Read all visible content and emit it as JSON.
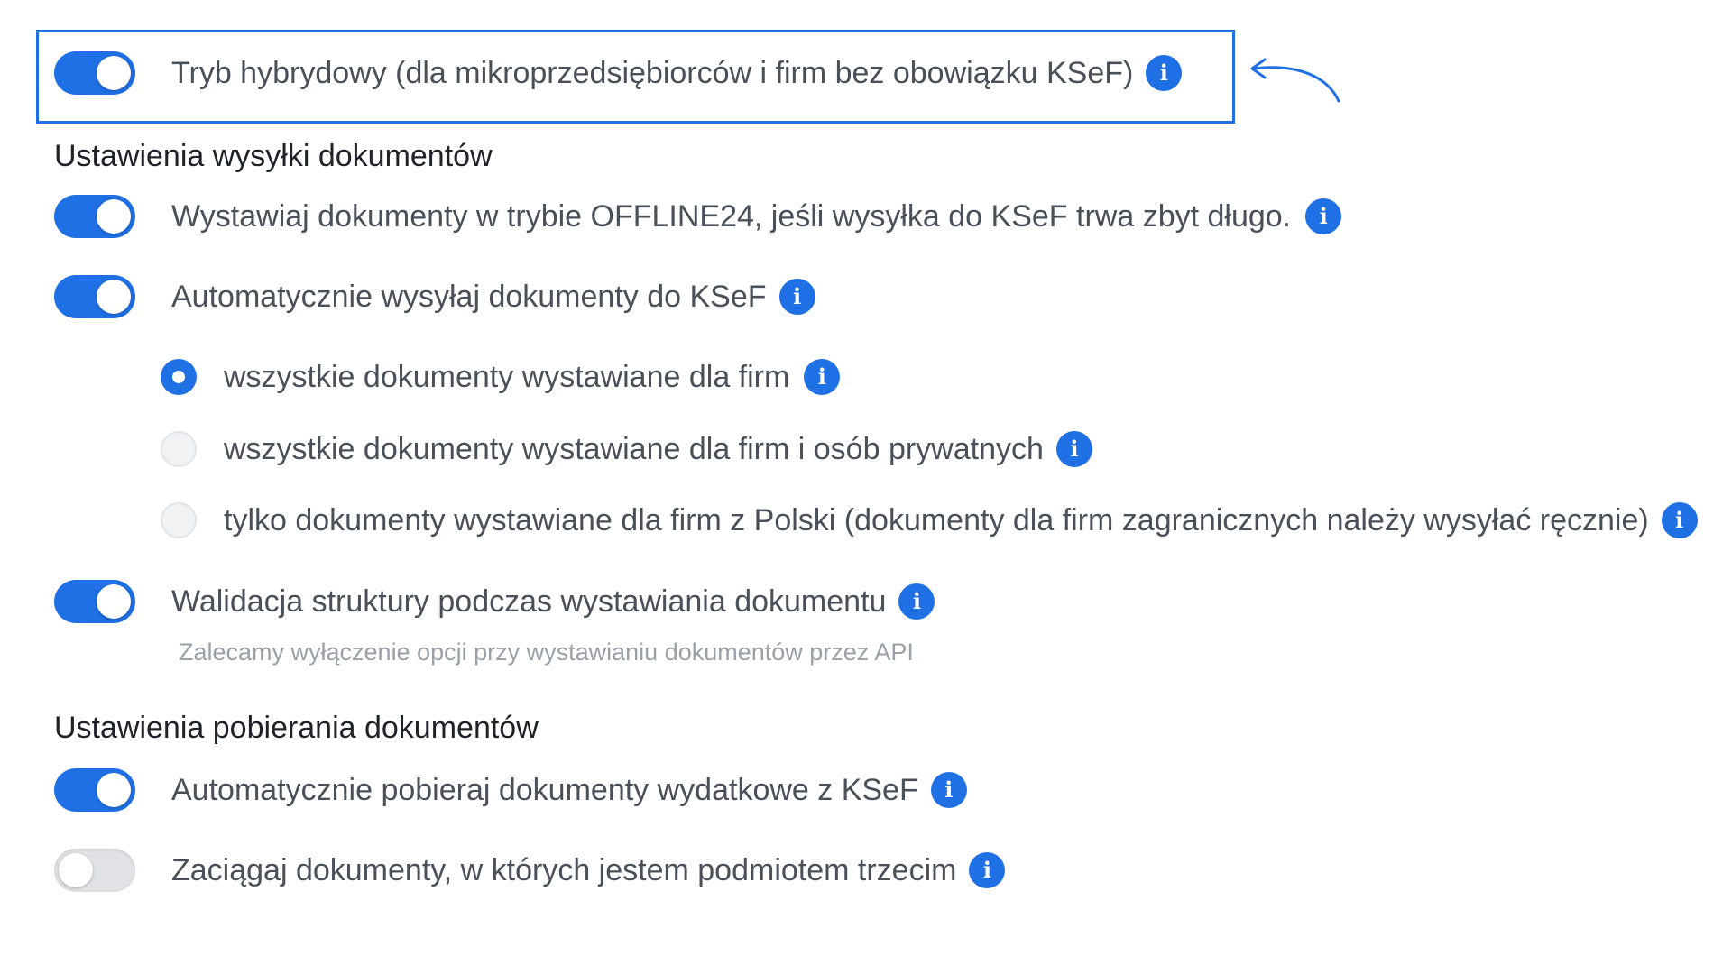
{
  "hybrid": {
    "label": "Tryb hybrydowy (dla mikroprzedsiębiorców i firm bez obowiązku KSeF)",
    "enabled": true,
    "info_icon": "info-icon"
  },
  "sending": {
    "heading": "Ustawienia wysyłki dokumentów",
    "offline24": {
      "label": "Wystawiaj dokumenty w trybie OFFLINE24, jeśli wysyłka do KSeF trwa zbyt długo.",
      "enabled": true
    },
    "auto_send": {
      "label": "Automatycznie wysyłaj dokumenty do KSeF",
      "enabled": true,
      "options": [
        {
          "label": "wszystkie dokumenty wystawiane dla firm",
          "selected": true
        },
        {
          "label": "wszystkie dokumenty wystawiane dla firm i osób prywatnych",
          "selected": false
        },
        {
          "label": "tylko dokumenty wystawiane dla firm z Polski (dokumenty dla firm zagranicznych należy wysyłać ręcznie)",
          "selected": false
        }
      ]
    },
    "validation": {
      "label": "Walidacja struktury podczas wystawiania dokumentu",
      "enabled": true,
      "hint": "Zalecamy wyłączenie opcji przy wystawianiu dokumentów przez API"
    }
  },
  "receiving": {
    "heading": "Ustawienia pobierania dokumentów",
    "auto_fetch": {
      "label": "Automatycznie pobieraj dokumenty wydatkowe z KSeF",
      "enabled": true
    },
    "third_party": {
      "label": "Zaciągaj dokumenty, w których jestem podmiotem trzecim",
      "enabled": false
    }
  },
  "info_glyph": "i",
  "colors": {
    "accent": "#1f6fe5",
    "toggle_off": "#e1e2e5",
    "text": "#4a505a",
    "heading": "#1f2329",
    "hint": "#9aa0a8"
  }
}
